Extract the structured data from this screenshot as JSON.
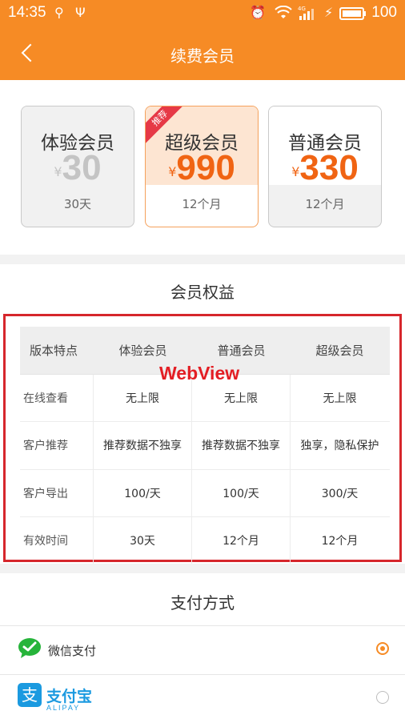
{
  "status_bar": {
    "time": "14:35",
    "battery": "100",
    "network": "4G"
  },
  "header": {
    "title": "续费会员"
  },
  "plans": [
    {
      "name": "体验会员",
      "currency": "¥",
      "price": "30",
      "duration": "30天"
    },
    {
      "name": "超级会员",
      "currency": "¥",
      "price": "990",
      "duration": "12个月",
      "badge": "推荐"
    },
    {
      "name": "普通会员",
      "currency": "¥",
      "price": "330",
      "duration": "12个月"
    }
  ],
  "benefits": {
    "title": "会员权益",
    "webview_label": "WebView",
    "table": {
      "headers": [
        "版本特点",
        "体验会员",
        "普通会员",
        "超级会员"
      ],
      "rows": [
        [
          "在线查看",
          "无上限",
          "无上限",
          "无上限"
        ],
        [
          "客户推荐",
          "推荐数据不独享",
          "推荐数据不独享",
          "独享，隐私保护"
        ],
        [
          "客户导出",
          "100/天",
          "100/天",
          "300/天"
        ],
        [
          "有效时间",
          "30天",
          "12个月",
          "12个月"
        ]
      ]
    }
  },
  "payment": {
    "title": "支付方式",
    "options": [
      {
        "label": "微信支付",
        "selected": true
      },
      {
        "label": "支付宝",
        "sub": "ALIPAY",
        "logo_char": "支",
        "selected": false
      }
    ]
  },
  "colors": {
    "accent": "#f68b25",
    "price": "#f06413",
    "webview_border": "#d6262c"
  }
}
